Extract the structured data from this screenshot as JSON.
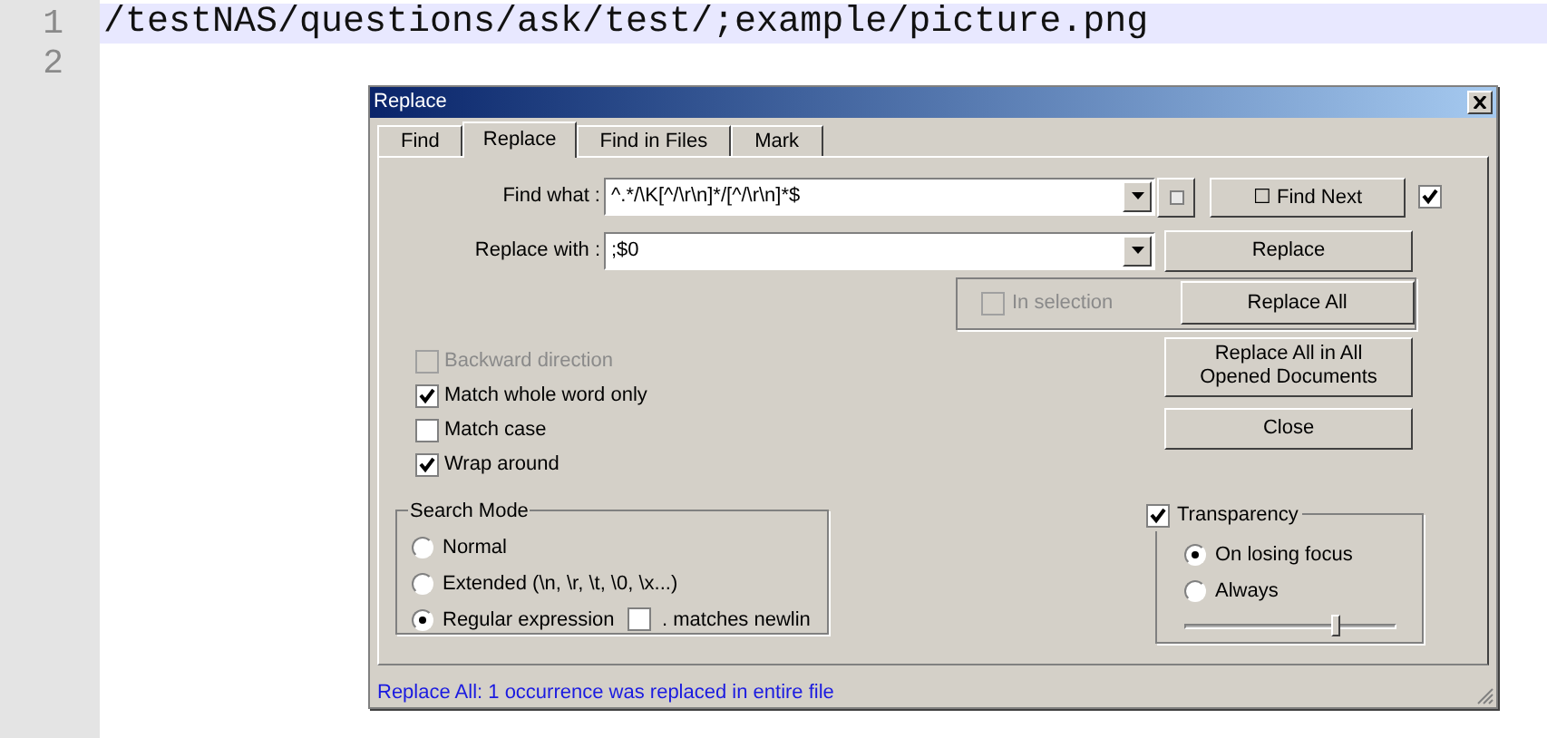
{
  "editor": {
    "lines": [
      {
        "number": "1",
        "text": "/testNAS/questions/ask/test/;example/picture.png",
        "selected": true
      },
      {
        "number": "2",
        "selected": false
      }
    ]
  },
  "dialog": {
    "title": "Replace",
    "tabs": [
      {
        "label": "Find",
        "selected": false
      },
      {
        "label": "Replace",
        "selected": true
      },
      {
        "label": "Find in Files",
        "selected": false
      },
      {
        "label": "Mark",
        "selected": false
      }
    ],
    "fields": [
      {
        "label": "Find what :",
        "value": "^.*/\\K[^/\\r\\n]*/[^/\\r\\n]*$"
      },
      {
        "label": "Replace with :",
        "value": ";$0"
      }
    ],
    "find_next": {
      "label": "☐ Find Next",
      "checked": true
    },
    "buttons": [
      {
        "label": "Replace"
      },
      {
        "label": "Replace All"
      },
      {
        "label": "Replace All in All Opened Documents"
      },
      {
        "label": "Close"
      }
    ],
    "in_selection": {
      "label": "In selection",
      "checked": false,
      "disabled": true
    },
    "options": [
      {
        "label": "Backward direction",
        "checked": false,
        "disabled": true
      },
      {
        "label": "Match whole word only",
        "checked": true,
        "disabled": false
      },
      {
        "label": "Match case",
        "checked": false,
        "disabled": false
      },
      {
        "label": "Wrap around",
        "checked": true,
        "disabled": false
      }
    ],
    "search_mode": {
      "title": "Search Mode",
      "modes": [
        {
          "label": "Normal",
          "selected": false
        },
        {
          "label": "Extended (\\n, \\r, \\t, \\0, \\x...)",
          "selected": false
        },
        {
          "label": "Regular expression",
          "selected": true
        }
      ],
      "dot_newline": {
        "label": ". matches newlin",
        "checked": false
      }
    },
    "transparency": {
      "label": "Transparency",
      "checked": true,
      "modes": [
        {
          "label": "On losing focus",
          "selected": true
        },
        {
          "label": "Always",
          "selected": false
        }
      ],
      "level": 0.72
    },
    "status": "Replace All: 1 occurrence was replaced in entire file"
  }
}
